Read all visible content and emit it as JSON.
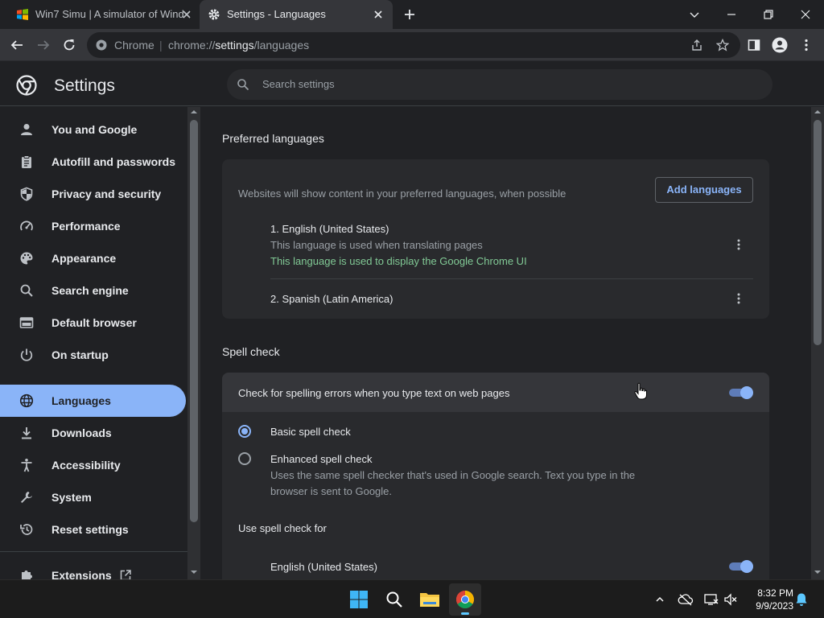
{
  "tabs": [
    {
      "title": "Win7 Simu | A simulator of Wind",
      "active": false
    },
    {
      "title": "Settings - Languages",
      "active": true
    }
  ],
  "toolbar": {
    "omnibox_scheme_label": "Chrome",
    "omnibox_separator": "|",
    "url_prefix": "chrome://",
    "url_host": "settings",
    "url_path": "/languages"
  },
  "header": {
    "title": "Settings",
    "search_placeholder": "Search settings"
  },
  "sidebar": {
    "items": [
      {
        "label": "You and Google",
        "icon": "person-icon"
      },
      {
        "label": "Autofill and passwords",
        "icon": "clipboard-icon"
      },
      {
        "label": "Privacy and security",
        "icon": "shield-icon"
      },
      {
        "label": "Performance",
        "icon": "speedometer-icon"
      },
      {
        "label": "Appearance",
        "icon": "palette-icon"
      },
      {
        "label": "Search engine",
        "icon": "search-icon"
      },
      {
        "label": "Default browser",
        "icon": "browser-icon"
      },
      {
        "label": "On startup",
        "icon": "power-icon"
      },
      {
        "label": "Languages",
        "icon": "globe-icon",
        "active": true
      },
      {
        "label": "Downloads",
        "icon": "download-icon"
      },
      {
        "label": "Accessibility",
        "icon": "accessibility-icon"
      },
      {
        "label": "System",
        "icon": "wrench-icon"
      },
      {
        "label": "Reset settings",
        "icon": "history-icon"
      },
      {
        "label": "Extensions",
        "icon": "puzzle-icon"
      }
    ]
  },
  "preferred_languages": {
    "title": "Preferred languages",
    "description": "Websites will show content in your preferred languages, when possible",
    "add_button": "Add languages",
    "languages": [
      {
        "name": "1. English (United States)",
        "note_translate": "This language is used when translating pages",
        "note_ui": "This language is used to display the Google Chrome UI"
      },
      {
        "name": "2. Spanish (Latin America)"
      }
    ]
  },
  "spell_check": {
    "title": "Spell check",
    "toggle_label": "Check for spelling errors when you type text on web pages",
    "toggle_on": true,
    "options": [
      {
        "label": "Basic spell check",
        "selected": true
      },
      {
        "label": "Enhanced spell check",
        "selected": false,
        "description_line1": "Uses the same spell checker that's used in Google search. Text you type in the",
        "description_line2": "browser is sent to Google."
      }
    ],
    "use_for_label": "Use spell check for",
    "use_for_languages": [
      {
        "name": "English (United States)",
        "on": true
      }
    ]
  },
  "taskbar": {
    "time": "8:32 PM",
    "date": "9/9/2023"
  },
  "colors": {
    "accent": "#8ab4f8",
    "background": "#202124",
    "card": "#292a2d",
    "green_note": "#81c995"
  }
}
